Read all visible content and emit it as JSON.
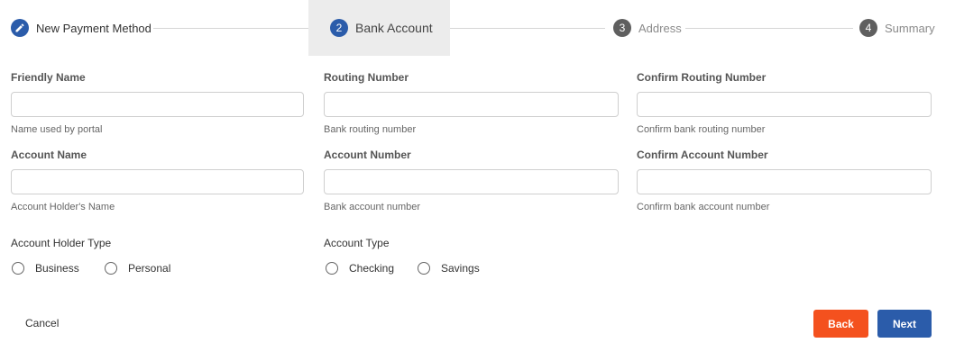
{
  "colors": {
    "accent": "#2b5caa",
    "step_inactive": "#5f5f5f",
    "back_button": "#f4511e",
    "next_button": "#2b5caa"
  },
  "stepper": {
    "steps": [
      {
        "label": "New Payment Method",
        "marker": "pencil-icon",
        "state": "completed"
      },
      {
        "label": "Bank Account",
        "marker": "2",
        "state": "active"
      },
      {
        "label": "Address",
        "marker": "3",
        "state": "inactive"
      },
      {
        "label": "Summary",
        "marker": "4",
        "state": "inactive"
      }
    ]
  },
  "form": {
    "friendly_name": {
      "label": "Friendly Name",
      "value": "",
      "helper": "Name used by portal"
    },
    "routing_number": {
      "label": "Routing Number",
      "value": "",
      "helper": "Bank routing number"
    },
    "confirm_routing_number": {
      "label": "Confirm Routing Number",
      "value": "",
      "helper": "Confirm bank routing number"
    },
    "account_name": {
      "label": "Account Name",
      "value": "",
      "helper": "Account Holder's Name"
    },
    "account_number": {
      "label": "Account Number",
      "value": "",
      "helper": "Bank account number"
    },
    "confirm_account_number": {
      "label": "Confirm Account Number",
      "value": "",
      "helper": "Confirm bank account number"
    },
    "account_holder_type": {
      "label": "Account Holder Type",
      "options": [
        "Business",
        "Personal"
      ],
      "selected": null
    },
    "account_type": {
      "label": "Account Type",
      "options": [
        "Checking",
        "Savings"
      ],
      "selected": null
    }
  },
  "footer": {
    "cancel_label": "Cancel",
    "back_label": "Back",
    "next_label": "Next"
  }
}
